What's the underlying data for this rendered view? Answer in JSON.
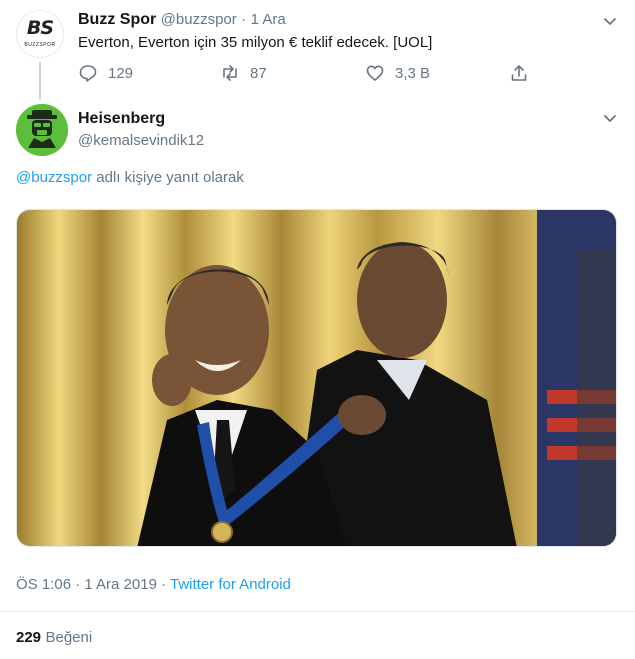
{
  "parent_tweet": {
    "avatar_text": "BS",
    "avatar_subtext": "BUZZSPOR",
    "name": "Buzz Spor",
    "handle": "@buzzspor",
    "separator": "·",
    "time": "1 Ara",
    "text": "Everton, Everton için 35 milyon € teklif edecek. [UOL]",
    "reply_count": "129",
    "retweet_count": "87",
    "like_count": "3,3 B"
  },
  "reply_tweet": {
    "name": "Heisenberg",
    "handle": "@kemalsevindik12",
    "reply_to_mention": "@buzzspor",
    "reply_to_suffix": " adlı kişiye yanıt olarak",
    "timestamp": "ÖS 1:06 · 1 Ara 2019",
    "separator": " · ",
    "source": "Twitter for Android",
    "likes_count": "229",
    "likes_label": "Beğeni"
  },
  "colors": {
    "accent": "#1da1f2",
    "muted": "#657786",
    "avatar_green": "#5cbf3a"
  }
}
